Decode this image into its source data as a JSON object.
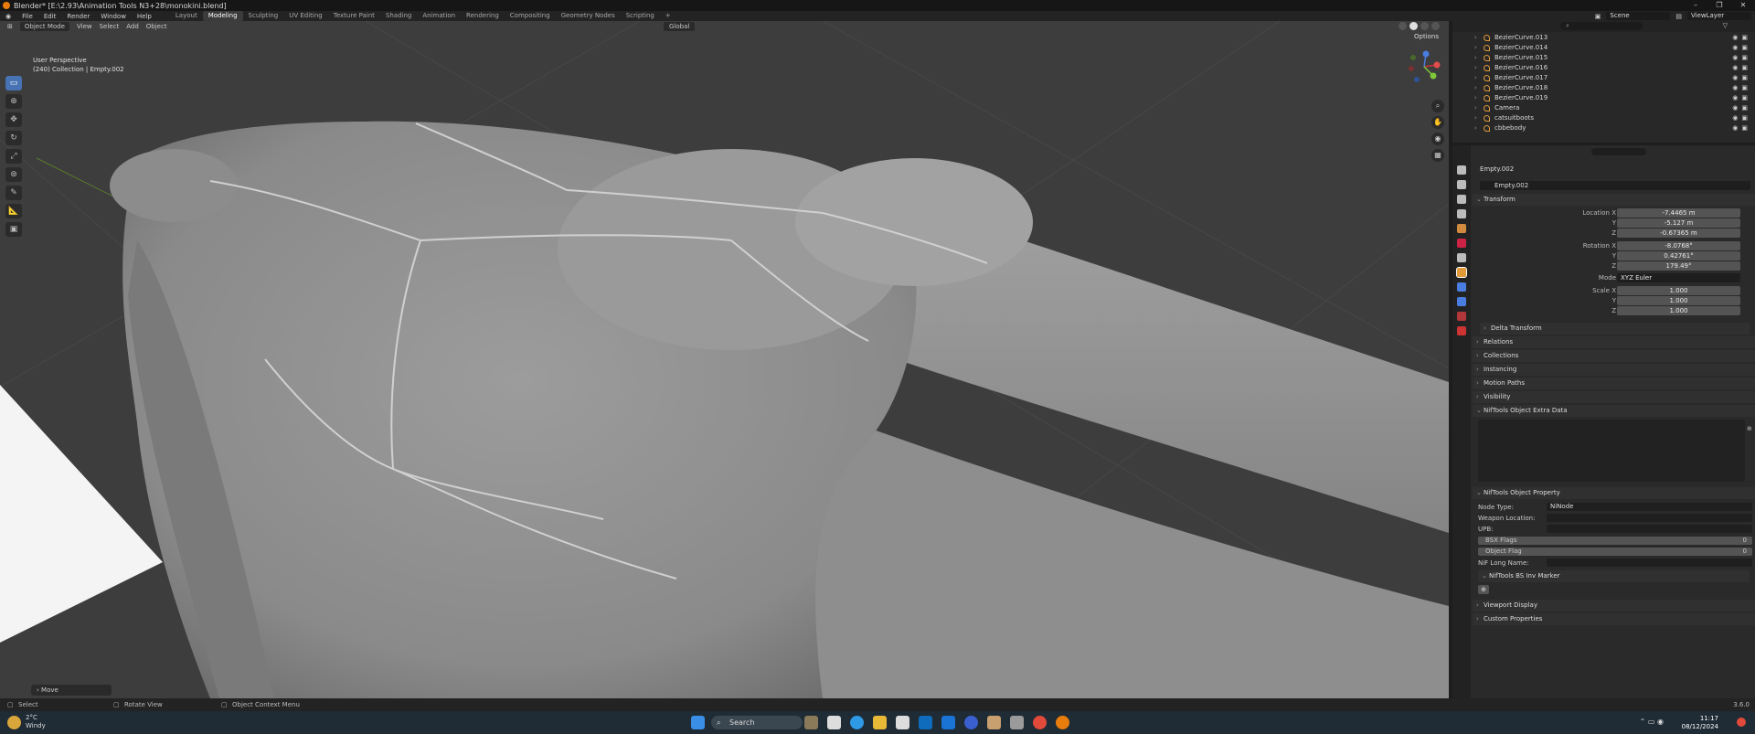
{
  "window": {
    "title": "Blender* [E:\\2.93\\Animation Tools N3+28\\monokini.blend]",
    "controls": [
      "–",
      "❐",
      "✕"
    ]
  },
  "menubar": {
    "menus": [
      "File",
      "Edit",
      "Render",
      "Window",
      "Help"
    ],
    "workspaces": [
      "Layout",
      "Modeling",
      "Sculpting",
      "UV Editing",
      "Texture Paint",
      "Shading",
      "Animation",
      "Rendering",
      "Compositing",
      "Geometry Nodes",
      "Scripting",
      "+"
    ],
    "active_workspace": "Modeling",
    "scene": "Scene",
    "view_layer": "ViewLayer"
  },
  "viewport": {
    "mode": "Object Mode",
    "menus": [
      "View",
      "Select",
      "Add",
      "Object"
    ],
    "orientation": "Global",
    "options": "Options",
    "perspective": "User Perspective",
    "collection_info": "(240) Collection | Empty.002",
    "last_op": "Move",
    "toolbar_icons": [
      "select-box-icon",
      "cursor-icon",
      "move-icon",
      "rotate-icon",
      "scale-icon",
      "transform-icon",
      "annotate-icon",
      "measure-icon",
      "add-cube-icon"
    ]
  },
  "outliner": {
    "items": [
      {
        "name": "BezierCurve.013"
      },
      {
        "name": "BezierCurve.014"
      },
      {
        "name": "BezierCurve.015"
      },
      {
        "name": "BezierCurve.016"
      },
      {
        "name": "BezierCurve.017"
      },
      {
        "name": "BezierCurve.018"
      },
      {
        "name": "BezierCurve.019"
      },
      {
        "name": "Camera"
      },
      {
        "name": "catsuitboots"
      },
      {
        "name": "cbbebody"
      }
    ]
  },
  "properties": {
    "object_header": "Empty.002",
    "object_name": "Empty.002",
    "transform": {
      "title": "Transform",
      "location": {
        "label": "Location X",
        "x": "-7.4465 m",
        "y": "-5.127 m",
        "z": "-0.67365 m"
      },
      "rotation": {
        "label": "Rotation X",
        "x": "-8.0768°",
        "y": "0.42761°",
        "z": "179.49°"
      },
      "mode_label": "Mode",
      "mode": "XYZ Euler",
      "scale": {
        "label": "Scale X",
        "x": "1.000",
        "y": "1.000",
        "z": "1.000"
      },
      "y_label": "Y",
      "z_label": "Z"
    },
    "sections": [
      "Delta Transform",
      "Relations",
      "Collections",
      "Instancing",
      "Motion Paths",
      "Visibility",
      "NifTools Object Extra Data"
    ],
    "niftools": {
      "title": "NifTools Object Property",
      "node_type_label": "Node Type:",
      "node_type": "NiNode",
      "weapon_location_label": "Weapon Location:",
      "upb_label": "UPB:",
      "bsx_flags_label": "BSX Flags",
      "bsx_flags": "0",
      "object_flag_label": "Object Flag",
      "object_flag": "0",
      "long_name_label": "NiF Long Name:",
      "inv_marker": "NifTools BS Inv Marker"
    },
    "bottom_sections": [
      "Viewport Display",
      "Custom Properties"
    ]
  },
  "statusbar": {
    "select": "Select",
    "rotate": "Rotate View",
    "context": "Object Context Menu",
    "version": "3.6.0"
  },
  "taskbar": {
    "temperature": "2°C",
    "weather": "Windy",
    "search": "Search",
    "time": "11:17",
    "date": "08/12/2024"
  }
}
